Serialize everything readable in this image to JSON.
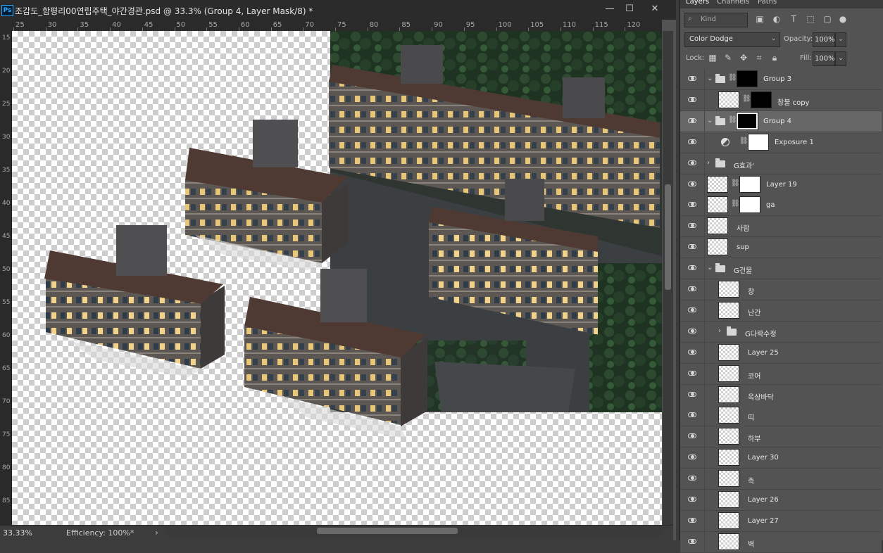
{
  "document": {
    "title": "조감도_함평리00연립주택_야간경관.psd @ 33.3% (Group 4, Layer Mask/8) *",
    "app_icon_text": "Ps",
    "window_buttons": {
      "minimize": "—",
      "maximize": "☐",
      "close": "✕"
    },
    "ruler_top": [
      "25",
      "30",
      "35",
      "40",
      "45",
      "50",
      "55",
      "60",
      "65",
      "70",
      "75",
      "80",
      "85",
      "90",
      "95",
      "100",
      "105",
      "110",
      "115",
      "120"
    ],
    "ruler_left": [
      "15",
      "20",
      "25",
      "30",
      "35",
      "40",
      "45",
      "50",
      "55",
      "60",
      "65",
      "70",
      "75",
      "80",
      "85"
    ],
    "status": {
      "zoom": "33.33%",
      "efficiency": "Efficiency: 100%*",
      "arrow": "›"
    }
  },
  "layers_panel": {
    "tabs": [
      "Layers",
      "Channels",
      "Paths"
    ],
    "active_tab": "Layers",
    "kind_filter": "Kind",
    "filter_icons": [
      "image-filter-icon",
      "adjustment-filter-icon",
      "type-filter-icon",
      "shape-filter-icon",
      "smart-object-filter-icon",
      "filter-toggle-icon"
    ],
    "blend_mode": "Color Dodge",
    "opacity_label": "Opacity:",
    "opacity": "100%",
    "lock_label": "Lock:",
    "fill_label": "Fill:",
    "fill": "100%",
    "lock_icons": [
      "lock-transparent-icon",
      "lock-image-icon",
      "lock-position-icon",
      "lock-artboard-icon",
      "lock-all-icon"
    ],
    "layers": [
      {
        "name": "Group 3",
        "type": "group",
        "expanded": true,
        "indent": 0,
        "mask": "black-shape",
        "selected": false
      },
      {
        "name": "창불 copy",
        "type": "pixel",
        "indent": 1,
        "mask": "black",
        "selected": false
      },
      {
        "name": "Group 4",
        "type": "group",
        "expanded": true,
        "indent": 0,
        "mask": "black-shape-selected",
        "selected": true
      },
      {
        "name": "Exposure 1",
        "type": "adjustment",
        "indent": 1,
        "mask": "white",
        "selected": false
      },
      {
        "name": "G효과'",
        "type": "group",
        "expanded": false,
        "indent": 0,
        "selected": false
      },
      {
        "name": "Layer 19",
        "type": "pixel",
        "indent": 0,
        "mask": "white",
        "selected": false
      },
      {
        "name": "ga",
        "type": "pixel",
        "indent": 0,
        "mask": "white",
        "selected": false
      },
      {
        "name": "사람",
        "type": "pixel",
        "indent": 0,
        "selected": false
      },
      {
        "name": "sup",
        "type": "pixel",
        "indent": 0,
        "selected": false
      },
      {
        "name": "G건물",
        "type": "group",
        "expanded": true,
        "indent": 0,
        "selected": false
      },
      {
        "name": "창",
        "type": "pixel",
        "indent": 1,
        "selected": false
      },
      {
        "name": "난간",
        "type": "pixel",
        "indent": 1,
        "selected": false
      },
      {
        "name": "G다락수정",
        "type": "group",
        "expanded": false,
        "indent": 1,
        "selected": false
      },
      {
        "name": "Layer 25",
        "type": "pixel",
        "indent": 1,
        "selected": false
      },
      {
        "name": "코어",
        "type": "pixel",
        "indent": 1,
        "selected": false
      },
      {
        "name": "옥상바닥",
        "type": "pixel",
        "indent": 1,
        "selected": false
      },
      {
        "name": "띠",
        "type": "pixel",
        "indent": 1,
        "selected": false
      },
      {
        "name": "하부",
        "type": "pixel",
        "indent": 1,
        "selected": false
      },
      {
        "name": "Layer 30",
        "type": "pixel",
        "indent": 1,
        "selected": false
      },
      {
        "name": "측",
        "type": "pixel",
        "indent": 1,
        "selected": false
      },
      {
        "name": "Layer 26",
        "type": "pixel",
        "indent": 1,
        "selected": false
      },
      {
        "name": "Layer 27",
        "type": "pixel",
        "indent": 1,
        "selected": false
      },
      {
        "name": "벽",
        "type": "pixel",
        "indent": 1,
        "selected": false
      }
    ]
  },
  "colors": {
    "ps_blue": "#31a8ff",
    "panel_bg": "#535353",
    "selected_row": "#676767",
    "night_scene": "#2c3a33"
  }
}
